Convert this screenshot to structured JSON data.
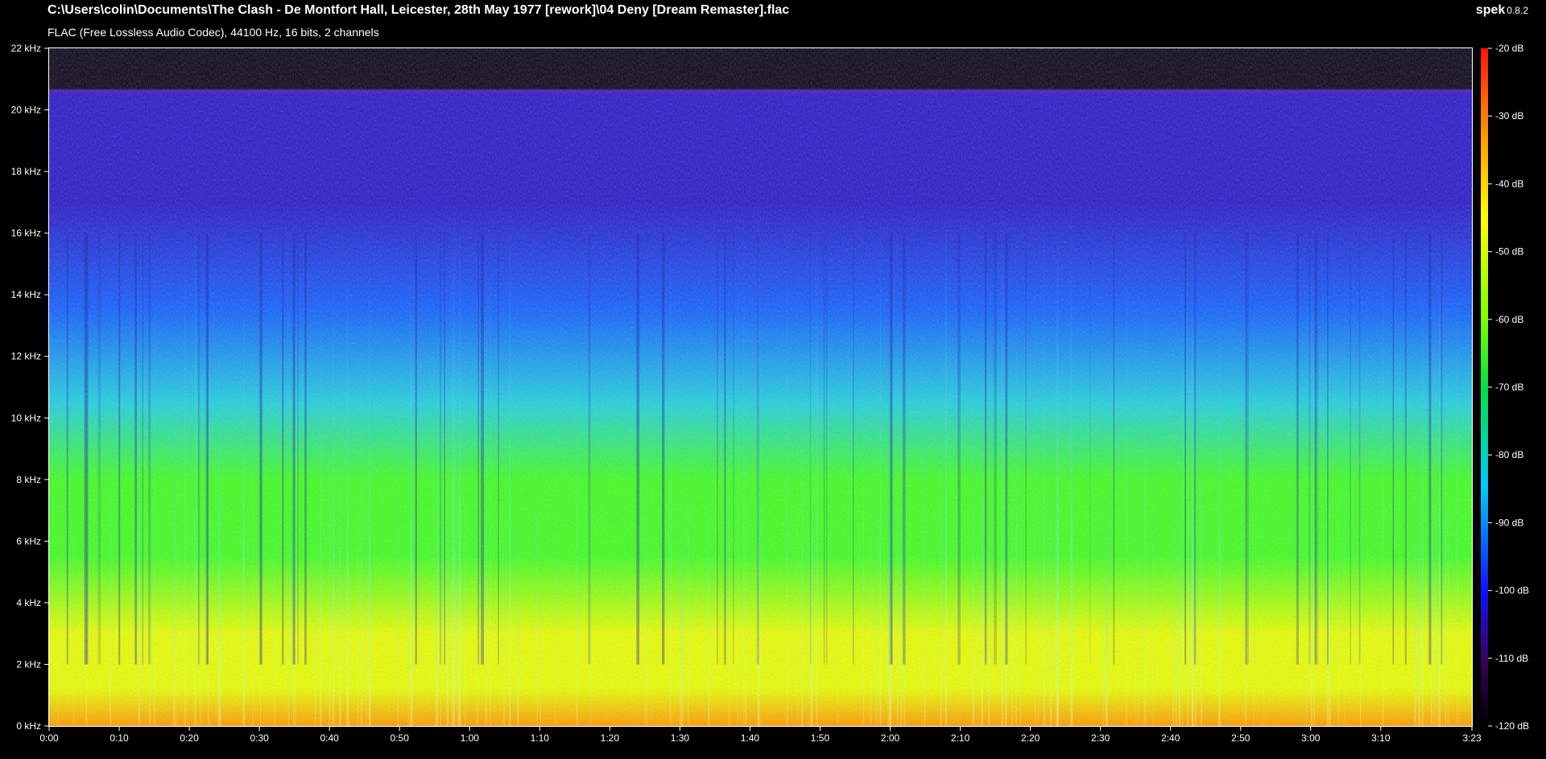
{
  "header": {
    "file_path": "C:\\Users\\colin\\Documents\\The Clash - De Montfort Hall, Leicester, 28th May 1977 [rework]\\04 Deny [Dream Remaster].flac",
    "file_info": "FLAC (Free Lossless Audio Codec), 44100 Hz, 16 bits, 2 channels",
    "app_name": "spek",
    "app_version": "0.8.2"
  },
  "chart_data": {
    "type": "heatmap",
    "title": "",
    "xlabel": "",
    "ylabel": "",
    "x_unit": "time (m:ss)",
    "y_unit": "kHz",
    "xlim_seconds": [
      0,
      203
    ],
    "ylim_khz": [
      0,
      22
    ],
    "x_ticks": [
      "0:00",
      "0:10",
      "0:20",
      "0:30",
      "0:40",
      "0:50",
      "1:00",
      "1:10",
      "1:20",
      "1:30",
      "1:40",
      "1:50",
      "2:00",
      "2:10",
      "2:20",
      "2:30",
      "2:40",
      "2:50",
      "3:00",
      "3:10",
      "3:23"
    ],
    "x_tick_seconds": [
      0,
      10,
      20,
      30,
      40,
      50,
      60,
      70,
      80,
      90,
      100,
      110,
      120,
      130,
      140,
      150,
      160,
      170,
      180,
      190,
      203
    ],
    "y_ticks": [
      "0 kHz",
      "2 kHz",
      "4 kHz",
      "6 kHz",
      "8 kHz",
      "10 kHz",
      "12 kHz",
      "14 kHz",
      "16 kHz",
      "18 kHz",
      "20 kHz",
      "22 kHz"
    ],
    "y_tick_khz": [
      0,
      2,
      4,
      6,
      8,
      10,
      12,
      14,
      16,
      18,
      20,
      22
    ],
    "colorbar": {
      "ticks": [
        "-20 dB",
        "-30 dB",
        "-40 dB",
        "-50 dB",
        "-60 dB",
        "-70 dB",
        "-80 dB",
        "-90 dB",
        "-100 dB",
        "-110 dB",
        "-120 dB"
      ],
      "tick_db": [
        -20,
        -30,
        -40,
        -50,
        -60,
        -70,
        -80,
        -90,
        -100,
        -110,
        -120
      ],
      "range_db": [
        -120,
        -20
      ],
      "stops": [
        {
          "db": -120,
          "color": "#000000"
        },
        {
          "db": -110,
          "color": "#3a0060"
        },
        {
          "db": -100,
          "color": "#1010ff"
        },
        {
          "db": -85,
          "color": "#00c8ff"
        },
        {
          "db": -70,
          "color": "#00e040"
        },
        {
          "db": -60,
          "color": "#7cff00"
        },
        {
          "db": -45,
          "color": "#ffff00"
        },
        {
          "db": -30,
          "color": "#ff8000"
        },
        {
          "db": -20,
          "color": "#ff1010"
        }
      ]
    },
    "observations": {
      "lowpass_cutoff_khz": 20.6,
      "colors": {
        "above_cutoff": "#0a0418",
        "cutoff_line": "#5a2ad8",
        "high_band": "#2a18c8",
        "mid_band": "#1060ff",
        "presence_band": "#20d0e0",
        "body_band": "#40ff20",
        "low_band": "#e8ff00",
        "bass_band": "#ff9a00"
      }
    }
  }
}
